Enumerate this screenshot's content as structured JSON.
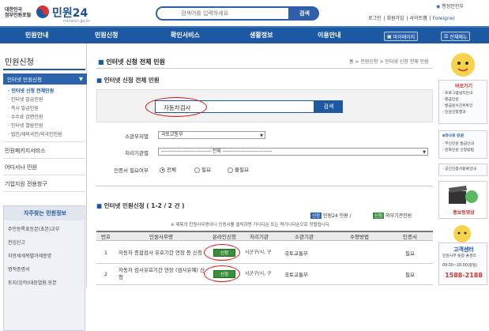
{
  "header": {
    "logo_line1": "대한민국",
    "logo_line2": "정부민원포털",
    "brand": "민원24",
    "domain": "minwon.go.kr",
    "search_placeholder": "검색어를 입력하세요",
    "search_button": "검색",
    "gov_badge": "행정안전부",
    "toplinks": [
      "로그인",
      "회원가입",
      "사이트맵",
      "Foreigner"
    ]
  },
  "gnb": {
    "items": [
      "민원안내",
      "민원신청",
      "확인서비스",
      "생활정보",
      "이용안내"
    ],
    "mypage": "마이페이지",
    "allmenu": "전체메뉴"
  },
  "lnb": {
    "title": "민원신청",
    "active": "인터넷 민원신청",
    "subs": [
      "· 인터넷 신청 전체민원",
      "· 인터넷 발급민원",
      "· 즉시 발급민원",
      "· 수수료 감면민원",
      "· 인터넷 열람민원",
      "· 법인/재외국민/외국인민원"
    ],
    "mains": [
      "민원패키지서비스",
      "어디서나 민원",
      "기업지원 전용창구"
    ],
    "popular_title": "자주찾는 민원정보",
    "popular_items": [
      "주민등록표등본(초본)교부",
      "전입신고",
      "지방세세목별과세증명",
      "병적증명서",
      "토지(임야)대장열람.등본"
    ]
  },
  "content": {
    "title": "인터넷 신청 전체 민원",
    "breadcrumb": "홈 > 민원신청 > 인터넷 신청 전체 민원",
    "section1": "인터넷 신청 전체 민원",
    "query": "자동차검사",
    "query_button": "검색",
    "labels": {
      "dept": "소관부처별",
      "org": "처리기관별",
      "login": "인증서 필요여부"
    },
    "dept_value": "국토교통부",
    "org_value": "----------------------------- 전체 -----------------------------",
    "radios": [
      "전체",
      "필요",
      "불필요"
    ],
    "section2": "인터넷 민원신청 ( 1-2 / 2 건 )",
    "legend1_tag": "신청",
    "legend1_text": "민원24 민원 /",
    "legend2_tag": "신청",
    "legend2_text": "외부기관민원",
    "note": "※ 제목의 민원사무명이나 인증서를 클릭하면 가나다순 또는 역가나다순으로 정렬됩니다.",
    "columns": [
      "번호",
      "민원사무명",
      "온라인신청",
      "처리기관",
      "소관기관",
      "수령방법",
      "인증서"
    ],
    "rows": [
      {
        "no": "1",
        "name": "자동차 종합검사 유효기간 연장 등 신청",
        "apply": "신청",
        "agency": "시군구/시, 구",
        "ministry": "국토교통부",
        "receipt": "",
        "cert": "필요"
      },
      {
        "no": "2",
        "name": "자동차 검사유효기간 연장 (검사유예) 신청",
        "apply": "신청",
        "agency": "시군구/시, 구",
        "ministry": "국토교통부",
        "receipt": "",
        "cert": "필요"
      }
    ]
  },
  "right": {
    "quick": "바로가기",
    "quick_items": [
      "· 프로그램설치안내",
      "· 발급민원",
      "· 발급문서진위확인",
      "· 민원신청결과"
    ],
    "mobile": "e하나로 민원",
    "mobile_items": [
      "· 무인민원 발급안내",
      "· 전화민원 신청방법"
    ],
    "guide": "· 공인인증서등록안내",
    "video": "홍보동영상",
    "center": "고객센터",
    "center_text1": "민원사무 통합 콜센터",
    "center_hours": "09:00~18:00(평일)",
    "phone": "1588-2188"
  }
}
